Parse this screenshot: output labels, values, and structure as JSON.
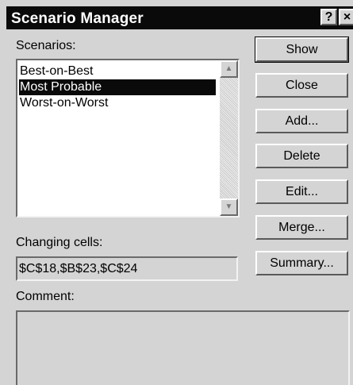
{
  "window": {
    "title": "Scenario Manager",
    "help_label": "?",
    "close_label": "×"
  },
  "scenarios": {
    "label": "Scenarios:",
    "items": [
      {
        "label": "Best-on-Best",
        "selected": false
      },
      {
        "label": "Most Probable",
        "selected": true
      },
      {
        "label": "Worst-on-Worst",
        "selected": false
      }
    ],
    "scroll_up_icon": "triangle-up",
    "scroll_down_icon": "triangle-down"
  },
  "buttons": {
    "show": "Show",
    "close": "Close",
    "add": "Add...",
    "delete": "Delete",
    "edit": "Edit...",
    "merge": "Merge...",
    "summary": "Summary..."
  },
  "changing_cells": {
    "label": "Changing cells:",
    "value": "$C$18,$B$23,$C$24"
  },
  "comment": {
    "label": "Comment:",
    "value": ""
  }
}
